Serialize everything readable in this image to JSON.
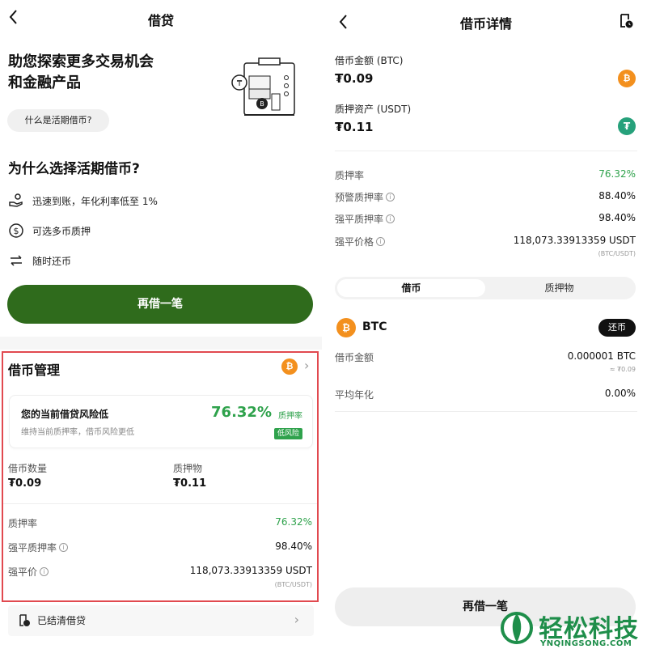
{
  "left": {
    "nav_title": "借贷",
    "hero_line1": "助您探索更多交易机会",
    "hero_line2": "和金融产品",
    "faq_label": "什么是活期借币?",
    "why_title": "为什么选择活期借币?",
    "features": [
      {
        "icon": "hand-coin-icon",
        "label": "迅速到账，年化利率低至 1%"
      },
      {
        "icon": "dollar-circle-icon",
        "label": "可选多币质押"
      },
      {
        "icon": "swap-arrows-icon",
        "label": "随时还币"
      }
    ],
    "borrow_again": "再借一笔",
    "management": {
      "title": "借币管理",
      "coin_badge": "₿",
      "risk_title": "您的当前借贷风险低",
      "risk_sub": "维持当前质押率，借币风险更低",
      "risk_pct": "76.32%",
      "risk_pct_label": "质押率",
      "risk_tag": "低风险",
      "borrow_qty_label": "借币数量",
      "borrow_qty_value": "₮0.09",
      "collateral_label": "质押物",
      "collateral_value": "₮0.11",
      "ltv_label": "质押率",
      "ltv_value": "76.32%",
      "liq_ltv_label": "强平质押率",
      "liq_ltv_value": "98.40%",
      "liq_price_label": "强平价",
      "liq_price_value": "118,073.33913359 USDT",
      "liq_price_unit": "(BTC/USDT)"
    },
    "settled_label": "已结清借贷"
  },
  "right": {
    "nav_title": "借币详情",
    "borrow_amount_label": "借币金额 (BTC)",
    "borrow_amount_value": "₮0.09",
    "collateral_label": "质押资产 (USDT)",
    "collateral_value": "₮0.11",
    "ltv_label": "质押率",
    "ltv_value": "76.32%",
    "warn_ltv_label": "预警质押率",
    "warn_ltv_value": "88.40%",
    "liq_ltv_label": "强平质押率",
    "liq_ltv_value": "98.40%",
    "liq_price_label": "强平价格",
    "liq_price_value": "118,073.33913359 USDT",
    "liq_price_unit": "(BTC/USDT)",
    "tab_borrow": "借币",
    "tab_collateral": "质押物",
    "coin_name": "BTC",
    "repay_label": "还币",
    "coin_amount_label": "借币金额",
    "coin_amount_value": "0.000001 BTC",
    "coin_amount_approx": "≈ ₮0.09",
    "apr_label": "平均年化",
    "apr_value": "0.00%",
    "borrow_again": "再借一笔"
  },
  "watermark": {
    "text": "轻松科技",
    "sub": "YNQINGSONG.COM"
  },
  "colors": {
    "primary_green": "#2f6b1c",
    "positive_green": "#2fa24c",
    "highlight_red": "#e1494f",
    "btc_orange": "#f3901e",
    "usdt_teal": "#26a17b"
  }
}
